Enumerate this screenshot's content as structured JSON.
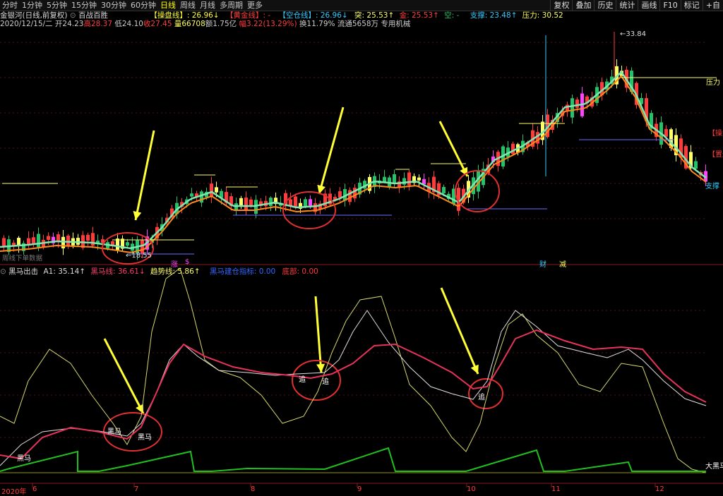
{
  "toolbar": {
    "periods": [
      "分时",
      "1分钟",
      "5分钟",
      "15分钟",
      "30分钟",
      "60分钟",
      "日线",
      "周线",
      "月线",
      "多周期",
      "更多"
    ],
    "active_period": "日线",
    "buttons": [
      "复权",
      "叠加",
      "历史",
      "统计",
      "画线",
      "F10",
      "标记",
      "+自"
    ]
  },
  "header": {
    "title": "金银河(日线,前复权)",
    "indicator_name": "百战百胜",
    "caopan_label": "【操盘线】: 26.96↓",
    "huangjin_label": "【黄金线】: -",
    "kongcang_label": "【空仓线】: 26.96↓",
    "tu_label": "突: 25.53↑",
    "jin_label": "金: 25.53↑",
    "kong_label": "空: -",
    "support_label": "支撑: 23.48↑",
    "pressure_label": "压力: 30.52"
  },
  "quote": {
    "date": "2020/12/15/二",
    "open": "开24.23",
    "high": "高28.37",
    "low": "低24.10",
    "close": "收27.45",
    "volume": "量66708",
    "amount": "额1.75亿",
    "change": "幅3.22(13.29%)",
    "turnover": "换11.79%",
    "float": "流通5658万",
    "tag": "专用机械"
  },
  "main_chart": {
    "max_price_label": "33.84",
    "min_price_label": "18.55",
    "right_labels": {
      "pressure": "压力",
      "caopan": "【操盘",
      "kongcang": "【置达",
      "support": "支撑"
    },
    "event_markers": [
      "涨",
      "$",
      "财",
      "减"
    ],
    "bottom_left_text": "周线下单数据",
    "candle_colors": {
      "up": "#ff3c3c",
      "down": "#26c26a",
      "yellow": "#ffff66",
      "magenta": "#ff44ff",
      "outline": "#ffffff"
    }
  },
  "sub_chart": {
    "header_name": "黑马出击",
    "a1_label": "A1: 35.14↑",
    "heima_label": "黑马线: 36.61↓",
    "trend_label": "趋势线: 5.86↑",
    "signal_label": "黑马建仓指标: 0.00",
    "bottom_label": "底部: 0.00",
    "annotations": {
      "heima_left": "黑马",
      "heima_a": "黑马",
      "heima_b": "黑马",
      "zhui_a": "追",
      "zhui_b": "追",
      "zhui_c": "追",
      "da_heima": "大黑马"
    }
  },
  "x_axis": {
    "labels": [
      "2020年",
      "6",
      "7",
      "8",
      "9",
      "10",
      "11",
      "12"
    ]
  },
  "colors": {
    "ma_orange": "#ff8c1a",
    "ma_mint": "#7fe8b0",
    "heima_line": "#e8325a",
    "yellow_line": "#d8d870",
    "white_line": "#e0e0e0",
    "trend_green": "#20c020",
    "arrow": "#ffff33",
    "circle": "#e03030"
  }
}
